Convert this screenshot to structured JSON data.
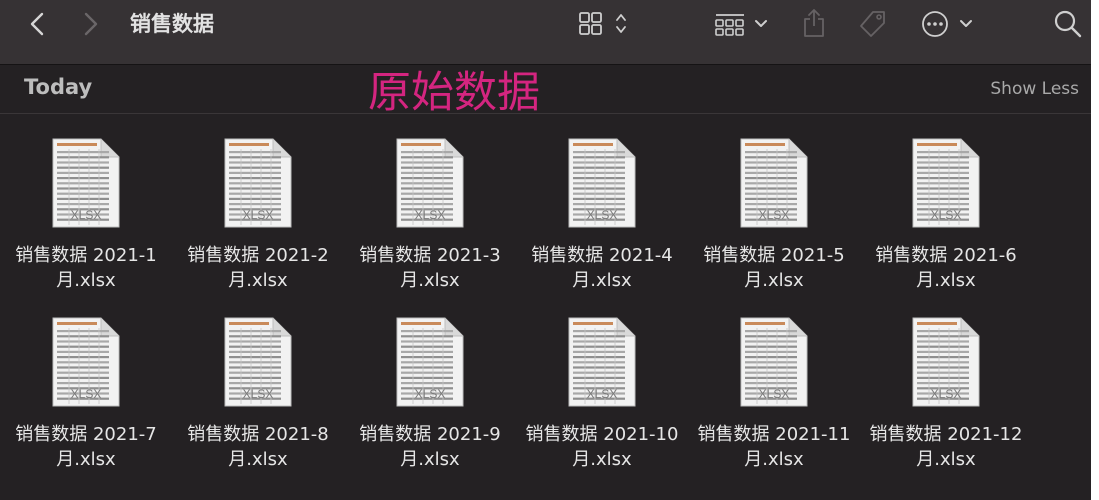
{
  "toolbar": {
    "back_icon": "chevron-left-icon",
    "forward_icon": "chevron-right-icon",
    "title": "销售数据",
    "view_icon": "grid-view-icon",
    "group_icon": "group-icon",
    "share_icon": "share-icon",
    "tag_icon": "tag-icon",
    "action_icon": "more-icon",
    "search_icon": "search-icon"
  },
  "section": {
    "title": "Today",
    "annotation": "原始数据",
    "show_less": "Show Less"
  },
  "files": [
    {
      "line1": "销售数据 2021-1",
      "line2": "月.xlsx",
      "badge": "XLSX"
    },
    {
      "line1": "销售数据 2021-2",
      "line2": "月.xlsx",
      "badge": "XLSX"
    },
    {
      "line1": "销售数据 2021-3",
      "line2": "月.xlsx",
      "badge": "XLSX"
    },
    {
      "line1": "销售数据 2021-4",
      "line2": "月.xlsx",
      "badge": "XLSX"
    },
    {
      "line1": "销售数据 2021-5",
      "line2": "月.xlsx",
      "badge": "XLSX"
    },
    {
      "line1": "销售数据 2021-6",
      "line2": "月.xlsx",
      "badge": "XLSX"
    },
    {
      "line1": "销售数据 2021-7",
      "line2": "月.xlsx",
      "badge": "XLSX"
    },
    {
      "line1": "销售数据 2021-8",
      "line2": "月.xlsx",
      "badge": "XLSX"
    },
    {
      "line1": "销售数据 2021-9",
      "line2": "月.xlsx",
      "badge": "XLSX"
    },
    {
      "line1": "销售数据 2021-10",
      "line2": "月.xlsx",
      "badge": "XLSX"
    },
    {
      "line1": "销售数据 2021-11",
      "line2": "月.xlsx",
      "badge": "XLSX"
    },
    {
      "line1": "销售数据 2021-12",
      "line2": "月.xlsx",
      "badge": "XLSX"
    }
  ],
  "colors": {
    "window_bg": "#242123",
    "toolbar_bg": "#363234",
    "annotation": "#d42580"
  }
}
